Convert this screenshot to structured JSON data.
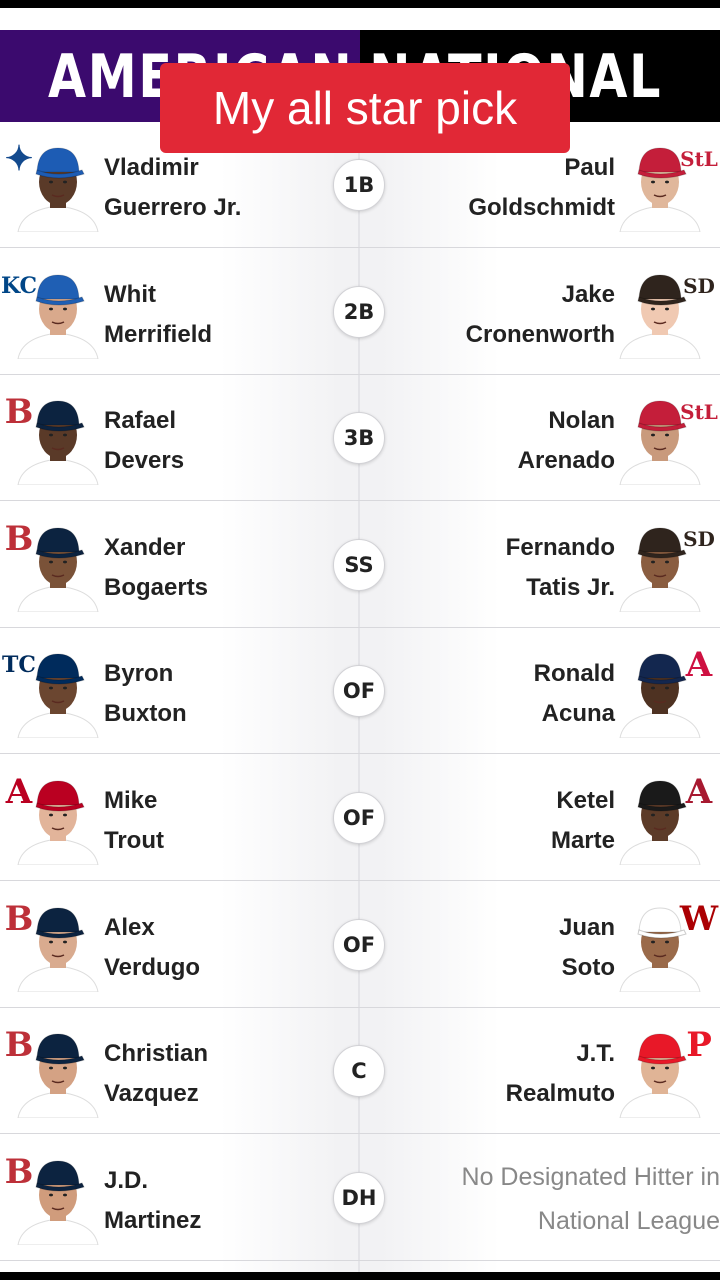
{
  "header": {
    "left": "AMERICAN",
    "right": "NATIONAL"
  },
  "banner": "My all star pick",
  "rows": [
    {
      "pos": "1B",
      "al": {
        "first": "Vladimir",
        "last": "Guerrero Jr.",
        "logo": "blue-jays-logo",
        "logo_text": "✦",
        "logo_color": "#134a8e",
        "cap": "#1d5cb4",
        "skin": "#5a3a28",
        "jersey": "#ffffff",
        "hair": "#1a1410"
      },
      "nl": {
        "first": "Paul",
        "last": "Goldschmidt",
        "logo": "cardinals-logo",
        "logo_text": "StL",
        "logo_color": "#c41e3a",
        "cap": "#c41e3a",
        "skin": "#e0b79b",
        "jersey": "#ffffff",
        "hair": null
      }
    },
    {
      "pos": "2B",
      "al": {
        "first": "Whit",
        "last": "Merrifield",
        "logo": "royals-logo",
        "logo_text": "KC",
        "logo_color": "#004687",
        "cap": "#1f5fb4",
        "skin": "#d9a98c",
        "jersey": "#ffffff",
        "hair": null
      },
      "nl": {
        "first": "Jake",
        "last": "Cronenworth",
        "logo": "padres-logo",
        "logo_text": "SD",
        "logo_color": "#2f241d",
        "cap": "#2f241d",
        "skin": "#f0c9b2",
        "jersey": "#ffffff",
        "hair": null
      }
    },
    {
      "pos": "3B",
      "al": {
        "first": "Rafael",
        "last": "Devers",
        "logo": "red-sox-logo",
        "logo_text": "B",
        "logo_color": "#bd3039",
        "cap": "#0c2340",
        "skin": "#5a3a28",
        "jersey": "#ffffff",
        "hair": null
      },
      "nl": {
        "first": "Nolan",
        "last": "Arenado",
        "logo": "cardinals-logo",
        "logo_text": "StL",
        "logo_color": "#c41e3a",
        "cap": "#c41e3a",
        "skin": "#c99a7c",
        "jersey": "#ffffff",
        "hair": null
      }
    },
    {
      "pos": "SS",
      "al": {
        "first": "Xander",
        "last": "Bogaerts",
        "logo": "red-sox-logo",
        "logo_text": "B",
        "logo_color": "#bd3039",
        "cap": "#0c2340",
        "skin": "#7a5238",
        "jersey": "#ffffff",
        "hair": null
      },
      "nl": {
        "first": "Fernando",
        "last": "Tatis Jr.",
        "logo": "padres-logo",
        "logo_text": "SD",
        "logo_color": "#2f241d",
        "cap": "#2f241d",
        "skin": "#8a5d40",
        "jersey": "#ffffff",
        "hair": null
      }
    },
    {
      "pos": "OF",
      "al": {
        "first": "Byron",
        "last": "Buxton",
        "logo": "twins-logo",
        "logo_text": "TC",
        "logo_color": "#002b5c",
        "cap": "#002b5c",
        "skin": "#6b4630",
        "jersey": "#ffffff",
        "hair": null
      },
      "nl": {
        "first": "Ronald",
        "last": "Acuna",
        "logo": "braves-logo",
        "logo_text": "A",
        "logo_color": "#ce1141",
        "cap": "#13274f",
        "skin": "#4e3222",
        "jersey": "#ffffff",
        "hair": null
      }
    },
    {
      "pos": "OF",
      "al": {
        "first": "Mike",
        "last": "Trout",
        "logo": "angels-logo",
        "logo_text": "A",
        "logo_color": "#ba0021",
        "cap": "#ba0021",
        "skin": "#e2b49a",
        "jersey": "#ffffff",
        "hair": null
      },
      "nl": {
        "first": "Ketel",
        "last": "Marte",
        "logo": "diamondbacks-logo",
        "logo_text": "A",
        "logo_color": "#a71930",
        "cap": "#1a1a1a",
        "skin": "#5c3b28",
        "jersey": "#ffffff",
        "hair": null
      }
    },
    {
      "pos": "OF",
      "al": {
        "first": "Alex",
        "last": "Verdugo",
        "logo": "red-sox-logo",
        "logo_text": "B",
        "logo_color": "#bd3039",
        "cap": "#0c2340",
        "skin": "#d9ab8f",
        "jersey": "#ffffff",
        "hair": null
      },
      "nl": {
        "first": "Juan",
        "last": "Soto",
        "logo": "nationals-logo",
        "logo_text": "W",
        "logo_color": "#ab0003",
        "cap": "#ffffff",
        "skin": "#9a6a4a",
        "jersey": "#ffffff",
        "hair": null
      }
    },
    {
      "pos": "C",
      "al": {
        "first": "Christian",
        "last": "Vazquez",
        "logo": "red-sox-logo",
        "logo_text": "B",
        "logo_color": "#bd3039",
        "cap": "#0c2340",
        "skin": "#d4a284",
        "jersey": "#ffffff",
        "hair": null
      },
      "nl": {
        "first": "J.T.",
        "last": "Realmuto",
        "logo": "phillies-logo",
        "logo_text": "P",
        "logo_color": "#e81828",
        "cap": "#e81828",
        "skin": "#e0b496",
        "jersey": "#ffffff",
        "hair": null
      }
    },
    {
      "pos": "DH",
      "al": {
        "first": "J.D.",
        "last": "Martinez",
        "logo": "red-sox-logo",
        "logo_text": "B",
        "logo_color": "#bd3039",
        "cap": "#0c2340",
        "skin": "#d09c7c",
        "jersey": "#ffffff",
        "hair": null
      },
      "nl": {
        "none_line1": "No Designated Hitter in",
        "none_line2": "National League"
      }
    }
  ]
}
